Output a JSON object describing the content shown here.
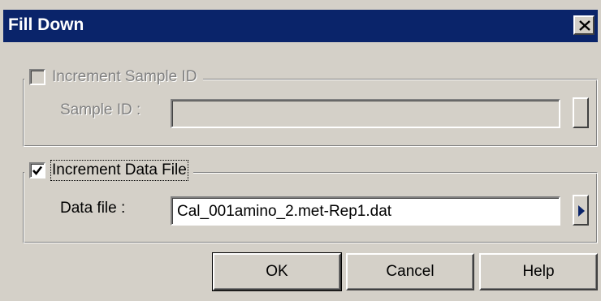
{
  "window": {
    "title": "Fill Down",
    "close_icon": "close-icon"
  },
  "sample_group": {
    "checkbox_label": "Increment Sample ID",
    "checked": false,
    "enabled": false,
    "field_label": "Sample ID :",
    "field_value": ""
  },
  "data_group": {
    "checkbox_label": "Increment Data File",
    "checked": true,
    "enabled": true,
    "field_label": "Data file :",
    "field_value": "Cal_001amino_2.met-Rep1.dat",
    "arrow_color": "#0a246a"
  },
  "buttons": {
    "ok": "OK",
    "cancel": "Cancel",
    "help": "Help"
  },
  "colors": {
    "titlebar": "#0a246a",
    "face": "#d4d0c8"
  }
}
